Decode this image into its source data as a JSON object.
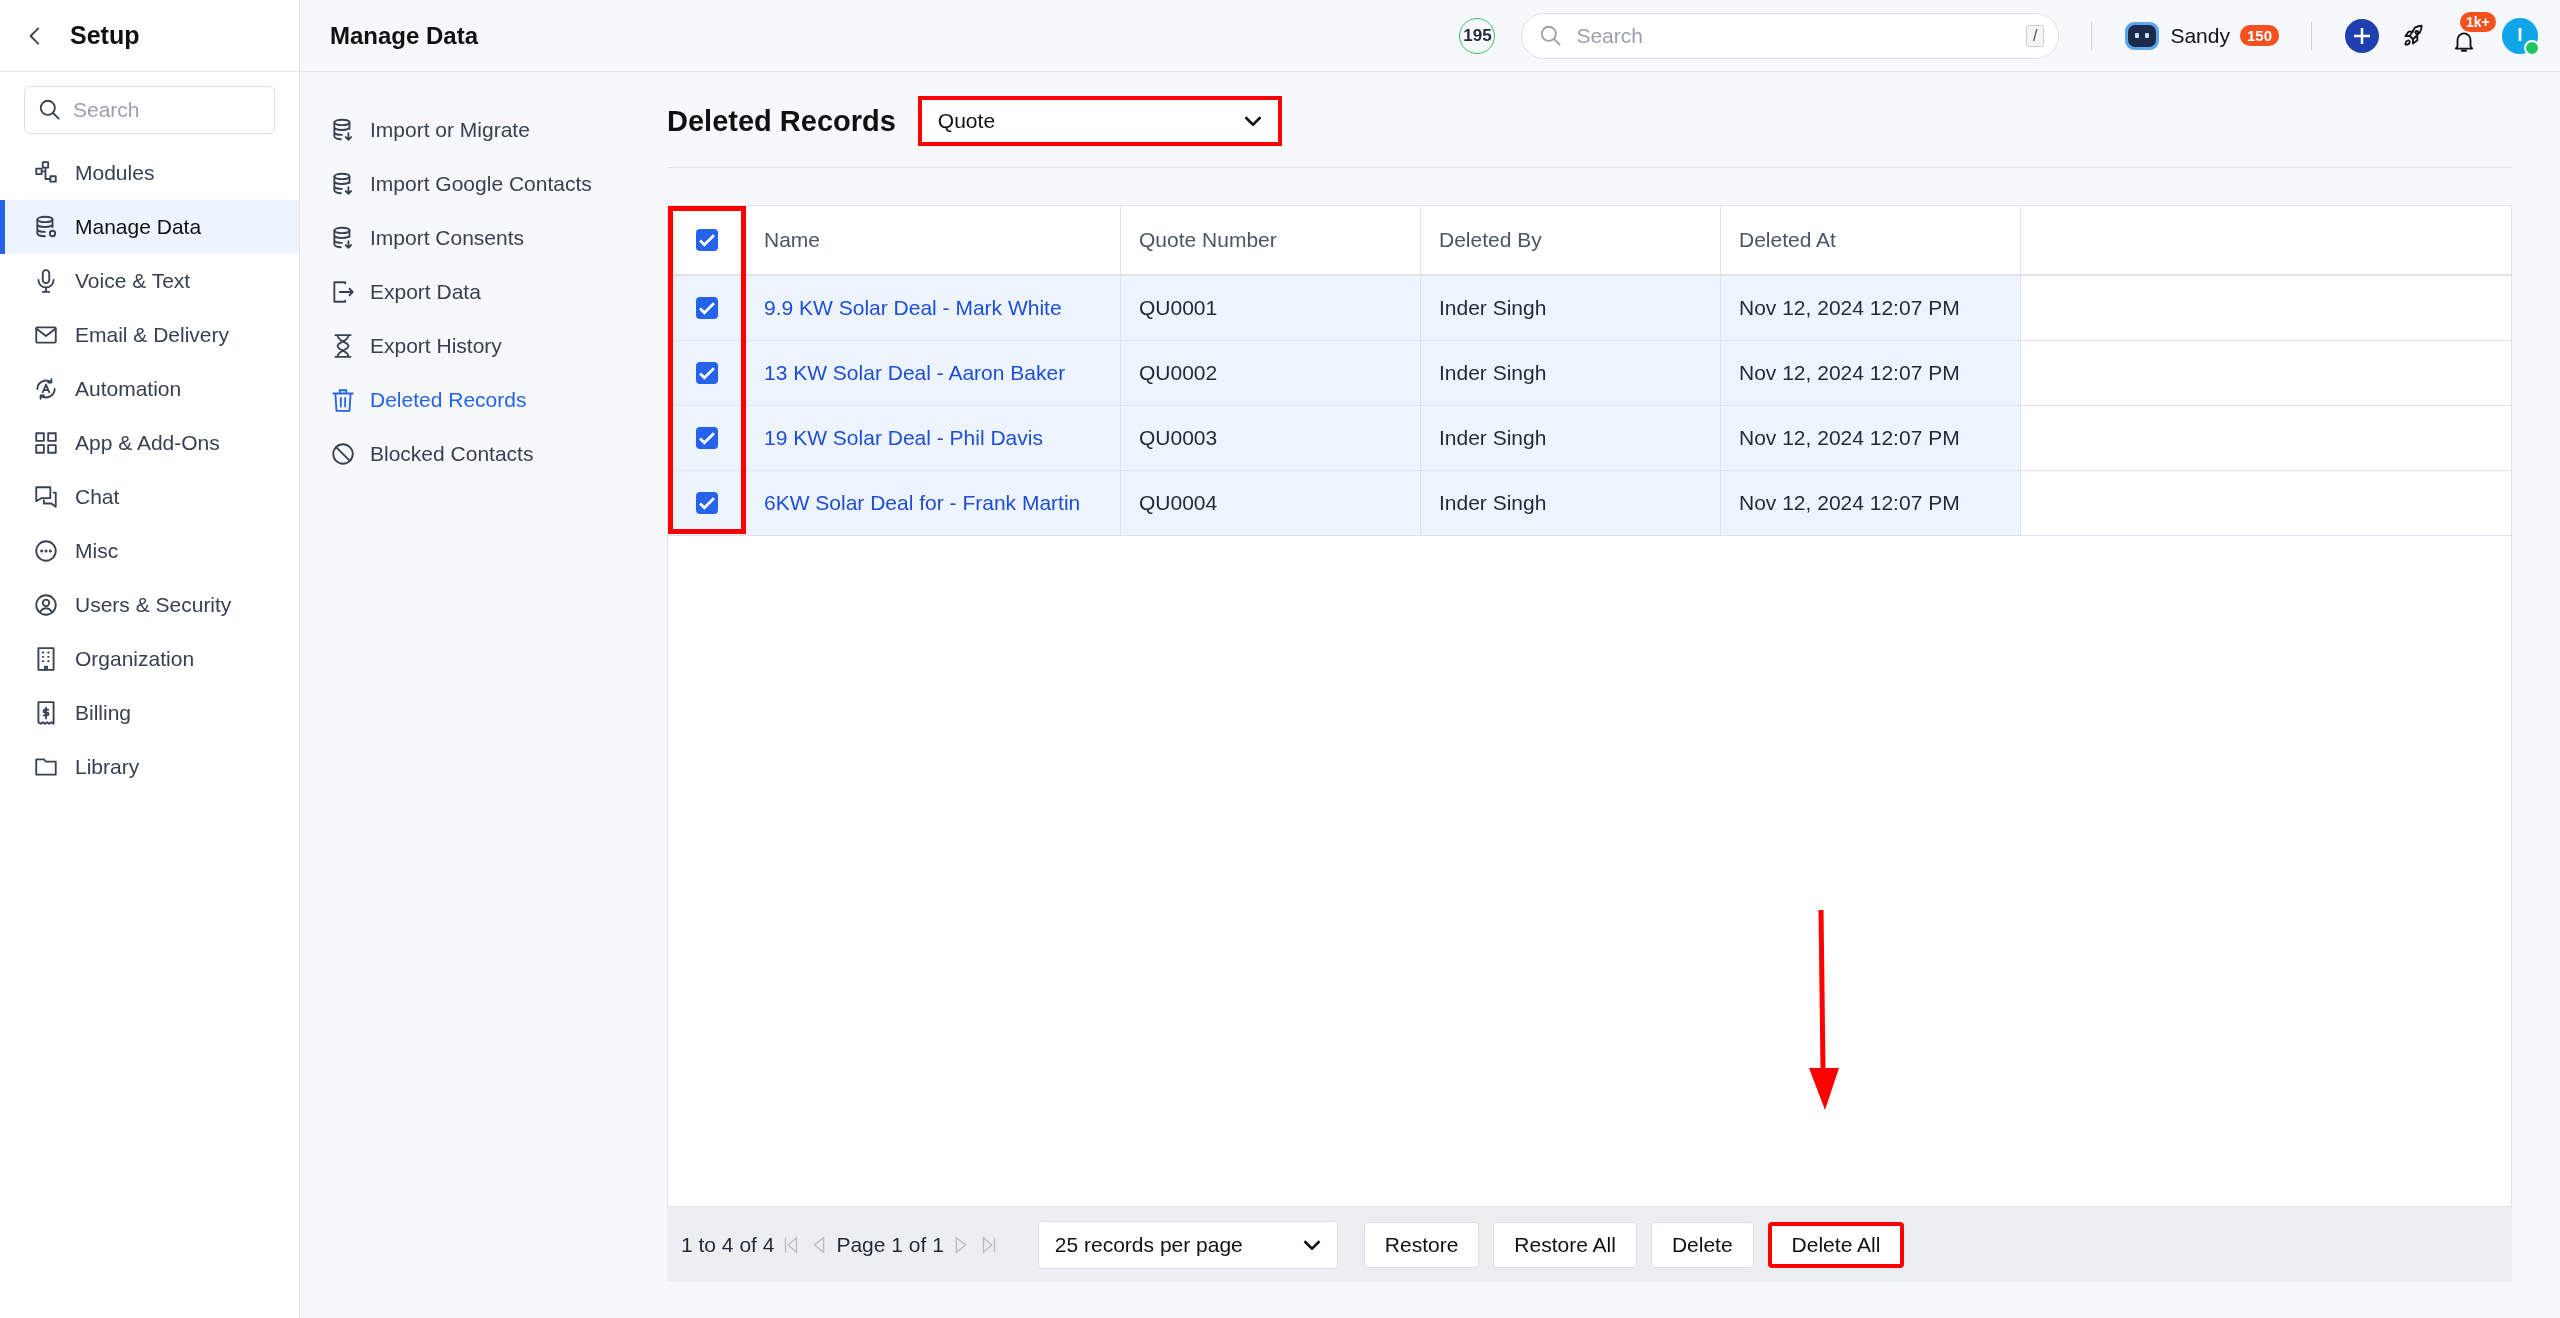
{
  "sidebar": {
    "title": "Setup",
    "search": {
      "placeholder": "Search"
    },
    "items": [
      {
        "label": "Modules",
        "selected": false
      },
      {
        "label": "Manage Data",
        "selected": true
      },
      {
        "label": "Voice & Text",
        "selected": false
      },
      {
        "label": "Email & Delivery",
        "selected": false
      },
      {
        "label": "Automation",
        "selected": false
      },
      {
        "label": "App & Add-Ons",
        "selected": false
      },
      {
        "label": "Chat",
        "selected": false
      },
      {
        "label": "Misc",
        "selected": false
      },
      {
        "label": "Users & Security",
        "selected": false
      },
      {
        "label": "Organization",
        "selected": false
      },
      {
        "label": "Billing",
        "selected": false
      },
      {
        "label": "Library",
        "selected": false
      }
    ]
  },
  "header": {
    "title": "Manage Data",
    "count_badge": "195",
    "search": {
      "placeholder": "Search",
      "shortcut": "/"
    },
    "user": {
      "name": "Sandy",
      "badge": "150"
    },
    "notifications": {
      "badge": "1k+"
    },
    "avatar": {
      "initial": "I",
      "online": true
    }
  },
  "subnav": {
    "items": [
      {
        "label": "Import or Migrate",
        "selected": false
      },
      {
        "label": "Import Google Contacts",
        "selected": false
      },
      {
        "label": "Import Consents",
        "selected": false
      },
      {
        "label": "Export Data",
        "selected": false
      },
      {
        "label": "Export History",
        "selected": false
      },
      {
        "label": "Deleted Records",
        "selected": true
      },
      {
        "label": "Blocked Contacts",
        "selected": false
      }
    ]
  },
  "content": {
    "title": "Deleted Records",
    "module_select": {
      "value": "Quote",
      "highlighted": true
    }
  },
  "table": {
    "select_all": {
      "checked": true
    },
    "checkbox_column_highlighted": true,
    "columns": [
      "Name",
      "Quote Number",
      "Deleted By",
      "Deleted At"
    ],
    "rows": [
      {
        "checked": true,
        "cells": [
          "9.9 KW Solar Deal - Mark White",
          "QU0001",
          "Inder Singh",
          "Nov 12, 2024 12:07 PM"
        ]
      },
      {
        "checked": true,
        "cells": [
          "13 KW Solar Deal - Aaron Baker",
          "QU0002",
          "Inder Singh",
          "Nov 12, 2024 12:07 PM"
        ]
      },
      {
        "checked": true,
        "cells": [
          "19 KW Solar Deal - Phil Davis",
          "QU0003",
          "Inder Singh",
          "Nov 12, 2024 12:07 PM"
        ]
      },
      {
        "checked": true,
        "cells": [
          "6KW Solar Deal for - Frank Martin",
          "QU0004",
          "Inder Singh",
          "Nov 12, 2024 12:07 PM"
        ]
      }
    ]
  },
  "footer": {
    "range": "1 to 4 of 4",
    "page": "Page 1 of 1",
    "per_page": "25 records per page",
    "buttons": [
      {
        "label": "Restore",
        "highlighted": false
      },
      {
        "label": "Restore All",
        "highlighted": false
      },
      {
        "label": "Delete",
        "highlighted": false
      },
      {
        "label": "Delete All",
        "highlighted": true
      }
    ]
  },
  "annotations": [
    {
      "kind": "arrow"
    }
  ]
}
